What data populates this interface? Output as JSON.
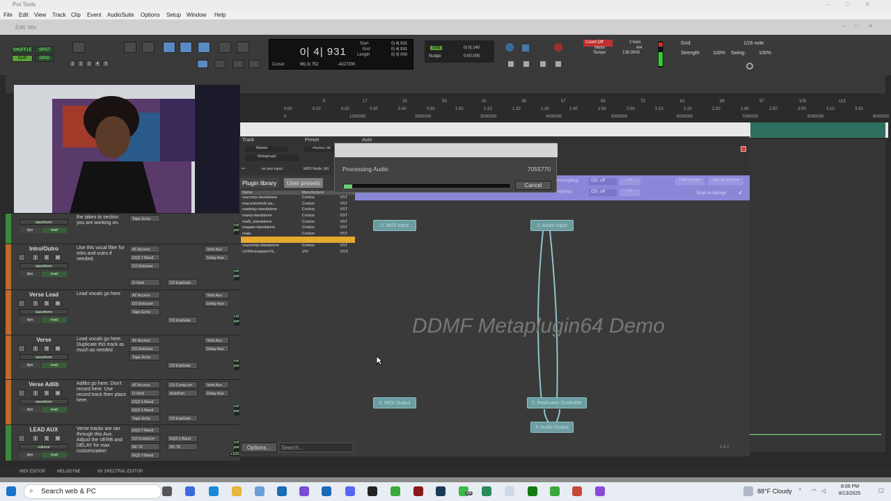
{
  "app": {
    "title": "Pro Tools",
    "session_title": "Edit: Mix"
  },
  "menu": [
    "File",
    "Edit",
    "View",
    "Track",
    "Clip",
    "Event",
    "AudioSuite",
    "Options",
    "Setup",
    "Window",
    "Help"
  ],
  "toolbar": {
    "modes": [
      "SHUFFLE",
      "SPOT",
      "SLIP",
      "GRID"
    ],
    "zoom_presets": [
      "1",
      "2",
      "3",
      "4",
      "5"
    ],
    "main_counter": "0| 4| 931",
    "start_label": "Start",
    "start_value": "0| 4| 931",
    "end_label": "End",
    "end_value": "0| 4| 931",
    "length_label": "Length",
    "length_value": "0| 0| 000",
    "cursor_label": "Cursor",
    "cursor_value": "96| 3| 752",
    "cursor_sample": "-4227200",
    "grid_toggle": "Grid",
    "grid_value": "0| 0| 240",
    "nudge_label": "Nudge",
    "nudge_value": "0:00.005",
    "count_off": "Count Off",
    "count_off_value": "2 bars",
    "meter_label": "Meter",
    "meter_value": "4/4",
    "tempo_label": "Tempo",
    "tempo_value": "138.0000",
    "grid_right_label": "Grid:",
    "grid_right_value": "1/16 note",
    "strength_label": "Strength:",
    "strength_value": "100%",
    "swing_label": "Swing:",
    "swing_value": "100%"
  },
  "ruler": {
    "bars": [
      "9",
      "17",
      "25",
      "33",
      "41",
      "49",
      "57",
      "65",
      "73",
      "81",
      "89",
      "97",
      "105",
      "113"
    ],
    "times": [
      "0:00",
      "0:10",
      "0:20",
      "0:30",
      "0:40",
      "0:50",
      "1:00",
      "1:10",
      "1:20",
      "1:30",
      "1:40",
      "1:50",
      "2:00",
      "2:10",
      "2:20",
      "2:30",
      "2:40",
      "2:50",
      "3:00",
      "3:10",
      "3:20"
    ],
    "samples": [
      "0",
      "1000000",
      "2000000",
      "3000000",
      "4000000",
      "5000000",
      "6000000",
      "7000000",
      "8000000",
      "9000000"
    ]
  },
  "tracks": [
    {
      "name": "",
      "note": "the takes to section you are working on.",
      "inserts": [
        "Tape Echo",
        "",
        ""
      ],
      "inserts2": [
        "",
        "",
        ""
      ],
      "sends": [
        "",
        "",
        ""
      ],
      "view": "waveform",
      "color": "#3a8a3a"
    },
    {
      "name": "Intro/Outro",
      "note": "Use this vocal filter for intro and outro if needed.",
      "inserts": [
        "AT Access",
        "EQ3 7-Band",
        "D3 DeEsser",
        "",
        "D-Verb"
      ],
      "inserts2": [
        "",
        "",
        "",
        "",
        "D3 ExpGate"
      ],
      "sends": [
        "Verb Aux",
        "Delay Aux"
      ],
      "view": "waveform",
      "color": "#c06a2a"
    },
    {
      "name": "Verse Lead",
      "note": "Lead vocals go here",
      "inserts": [
        "AT Access",
        "D3 DeEsser",
        "Tape Echo"
      ],
      "inserts2": [
        "",
        "",
        "",
        "D3 ExpGate"
      ],
      "sends": [
        "Verb Aux",
        "Delay Aux"
      ],
      "view": "waveform",
      "color": "#c06a2a"
    },
    {
      "name": "Verse",
      "note": "Lead vocals go here. Duplicate this track as much as needed",
      "inserts": [
        "AT Access",
        "D3 DeEsser",
        "Tape Echo"
      ],
      "inserts2": [
        "",
        "",
        "",
        "D3 ExpGate"
      ],
      "sends": [
        "Verb Aux",
        "Delay Aux"
      ],
      "view": "waveform",
      "color": "#c06a2a"
    },
    {
      "name": "Verse Adlib",
      "note": "Adlibs go here. Don't record here. Use record track then place here.",
      "inserts": [
        "AT Access",
        "D-Verb",
        "EQ3 1-Band",
        "EQ3 1-Band",
        "Tape Echo"
      ],
      "inserts2": [
        "D3 CompLim",
        "AutoPan",
        "",
        "",
        "D3 ExpGate"
      ],
      "sends": [
        "Verb Aux",
        "Delay Aux"
      ],
      "view": "waveform",
      "color": "#c06a2a"
    },
    {
      "name": "LEAD AUX",
      "note": "Verse tracks are ran through this Aux. Adjust the VERB and DELAY for max customization",
      "inserts": [
        "EQ3 7-Band",
        "D3 CompLim",
        "BF-76",
        "EQ3 7-Band"
      ],
      "inserts2": [
        "",
        "EQ3 1-Band",
        "BF-76",
        ""
      ],
      "sends": [],
      "view": "volume",
      "color": "#3a8a3a"
    }
  ],
  "track_controls": {
    "solo": "S",
    "mute": "M",
    "input": "I",
    "dyn": "dyn",
    "read": "read",
    "vol": "vol",
    "pan": "pan",
    "vol_value": "+100",
    "pan_value": "100"
  },
  "plugin": {
    "track_label": "Track",
    "preset_label": "Preset",
    "auto_label": "Auto",
    "track_value": "Master",
    "plugin_value": "Metaplugin",
    "preset_value": "<factory de",
    "key_input": "no key input",
    "midi_node": "MIDI Node: [A]",
    "tab_library": "Plugin library",
    "tab_user": "User presets",
    "col_name": "Name",
    "col_manufacturer": "Manufacturer",
    "library": [
      {
        "name": "reacomp-standalone",
        "mfr": "Cockos",
        "type": "VST"
      },
      {
        "name": "reacontrolmidi-sta...",
        "mfr": "Cockos",
        "type": "VST"
      },
      {
        "name": "readelay-standalone",
        "mfr": "Cockos",
        "type": "VST"
      },
      {
        "name": "reaeq-standalone",
        "mfr": "Cockos",
        "type": "VST"
      },
      {
        "name": "reafir_standalone",
        "mfr": "Cockos",
        "type": "VST"
      },
      {
        "name": "reagate-standalone",
        "mfr": "Cockos",
        "type": "VST"
      },
      {
        "name": "reaja",
        "mfr": "Cockos",
        "type": "VST"
      },
      {
        "name": "",
        "mfr": "",
        "type": "VST",
        "selected": true
      },
      {
        "name": "reaxcomp-standalone",
        "mfr": "Cockos",
        "type": "VST"
      },
      {
        "name": "UVIWorkstationVS...",
        "mfr": "UVI",
        "type": "VSTi"
      }
    ],
    "oversampling": "Oversampling:",
    "os_off": "OS: off",
    "oversampling2": "Oversampling:",
    "os_off2": "OS: off",
    "full_version": "Full version",
    "set_license": "Set up license",
    "scan_in_background": "Scan in backgr",
    "nodes": {
      "midi_input": "0: MIDI Input",
      "audio_input": "1: Audio Input",
      "midi_output": "0: MIDI Output",
      "replicator": "2: Replicator-Scaleable",
      "audio_output": "3: Audio Output"
    },
    "demo_text": "DDMF Metaplugin64 Demo",
    "options_btn": "Options...",
    "search_placeholder": "Search...",
    "version": "4.4.2"
  },
  "dialog": {
    "title": "Processing Audio",
    "number": "7055770",
    "progress": 0.05,
    "cancel": "Cancel"
  },
  "bottom_tabs": [
    "MIDI EDITOR",
    "MELODYNE",
    "KK SPECTRAL EDITOR"
  ],
  "taskbar": {
    "search_placeholder": "Search web & PC",
    "weather": "88°F  Cloudy",
    "time": "8:06 PM",
    "date": "8/13/2025",
    "badge": "29"
  }
}
